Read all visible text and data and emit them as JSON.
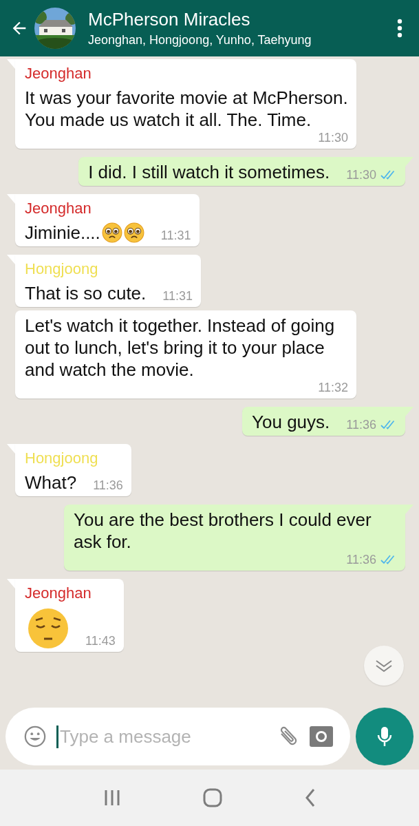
{
  "header": {
    "title": "McPherson Miracles",
    "subtitle": "Jeonghan, Hongjoong, Yunho, Taehyung"
  },
  "messages": [
    {
      "kind": "received",
      "sender": "Jeonghan",
      "color": "#d42a2a",
      "tail": true,
      "text": "It was your favorite movie at McPherson. You made us watch it all. The. Time.",
      "time": "11:30"
    },
    {
      "kind": "sent",
      "tail": true,
      "text": "I did. I still watch it sometimes.",
      "time": "11:30",
      "read": true
    },
    {
      "kind": "received",
      "sender": "Jeonghan",
      "color": "#d42a2a",
      "tail": true,
      "text": "Jiminie....",
      "emojis": [
        {
          "kind": "pleading"
        },
        {
          "kind": "pleading"
        }
      ],
      "time": "11:31"
    },
    {
      "kind": "received",
      "sender": "Hongjoong",
      "color": "#efdf52",
      "tail": true,
      "text": "That is so cute.",
      "time": "11:31"
    },
    {
      "kind": "received",
      "tail": false,
      "text": "Let's watch it together. Instead of going out to lunch, let's bring it to your place and watch the movie.",
      "time": "11:32"
    },
    {
      "kind": "sent",
      "tail": true,
      "text": "You guys.",
      "time": "11:36",
      "read": true
    },
    {
      "kind": "received",
      "sender": "Hongjoong",
      "color": "#efdf52",
      "tail": true,
      "text": "What?",
      "time": "11:36"
    },
    {
      "kind": "sent",
      "tail": true,
      "text": "You are the best brothers I could ever ask for.",
      "time": "11:36",
      "read": true
    },
    {
      "kind": "received",
      "sender": "Jeonghan",
      "color": "#d42a2a",
      "tail": true,
      "emojis": [
        {
          "kind": "pensive"
        }
      ],
      "time": "11:43"
    }
  ],
  "composer": {
    "placeholder": "Type a message"
  }
}
